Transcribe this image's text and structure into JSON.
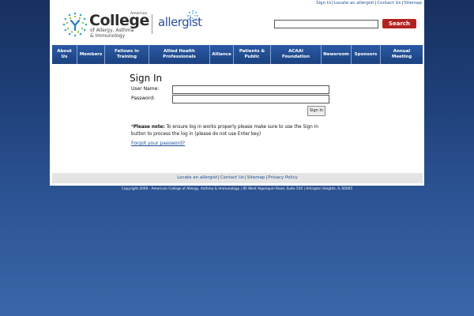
{
  "util_links": [
    "Sign In",
    "Locate an allergist",
    "Contact Us",
    "Sitemap"
  ],
  "logo": {
    "small": "American",
    "college": "College",
    "sub_line1": "of Allergy, Asthma",
    "sub_line2": "& Immunology",
    "allergist": "allergist"
  },
  "search": {
    "placeholder": "",
    "button_label": "Search"
  },
  "nav": [
    {
      "line1": "About",
      "line2": "Us"
    },
    {
      "line1": "Members",
      "line2": ""
    },
    {
      "line1": "Fellows in",
      "line2": "Training"
    },
    {
      "line1": "Allied Health",
      "line2": "Professionals"
    },
    {
      "line1": "Alliance",
      "line2": ""
    },
    {
      "line1": "Patients &",
      "line2": "Public"
    },
    {
      "line1": "ACAAI",
      "line2": "Foundation"
    },
    {
      "line1": "Newsroom",
      "line2": ""
    },
    {
      "line1": "Sponsors",
      "line2": ""
    },
    {
      "line1": "Annual",
      "line2": "Meeting"
    }
  ],
  "signin": {
    "title": "Sign In",
    "username_label": "User Name:",
    "password_label": "Password:",
    "button_label": "Sign In",
    "note_label": "Please note:",
    "note_line1": "To ensure log in works properly please make sure to use the Sign In",
    "note_line2": "button to process the log in (please do not use Enter key)",
    "forgot": "Forgot your password?"
  },
  "footer_links": [
    "Locate an allergist",
    "Contact Us",
    "Sitemap",
    "Privacy Policy"
  ],
  "copyright": "Copyright 2009 - American College of Allergy, Asthma & Immunology | 85 West Algonquin Road, Suite 550 | Arlington Heights, IL 60005",
  "colors": {
    "brand_blue": "#1a4f99",
    "search_red": "#b22222",
    "nav_top": "#2a5aa6",
    "nav_bottom": "#1b427f"
  }
}
